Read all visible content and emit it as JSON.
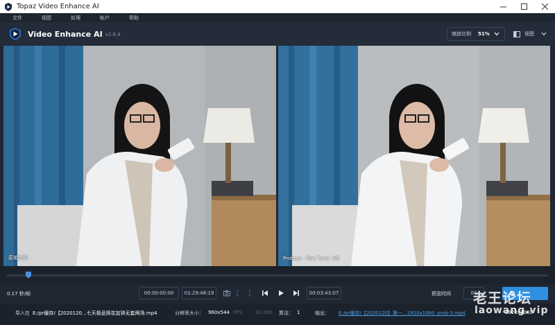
{
  "window": {
    "title": "Topaz Video Enhance AI"
  },
  "menu": [
    "文件",
    "视图",
    "处理",
    "帐户",
    "帮助"
  ],
  "header": {
    "brand": "Video Enhance AI",
    "version": "v2.6.4",
    "zoom_label": "缩放比例",
    "zoom_value": "51%",
    "view_label": "视图"
  },
  "preview": {
    "left_label": "原始比例",
    "right_label": "Proteus - Fine Tune: HD"
  },
  "timeline": {
    "position": 0.04
  },
  "controls": {
    "fps_rate": "0.17 秒/帧",
    "start_time": "00:00:00:00",
    "end_time": "01:29:48:19",
    "current_time": "00:03:43:07",
    "preview_time_label": "预览时间",
    "preview_time_value": "00"
  },
  "info": {
    "import_label": "导入在",
    "import_path": "E:/pr缓存/【2020120...七天极品探花加钟无套两场.mp4",
    "resolution_label": "分辨率大小：",
    "resolution_value": "960x544",
    "fps_label": "FPS:",
    "fps_value": "30.000",
    "algo_label": "算法：",
    "algo_value": "1",
    "output_label": "输出：",
    "output_path": "E:/pr缓存/【2020120】第一...1920x1080_prob-3.mp4",
    "output_size": "1920x1080"
  },
  "watermark": {
    "line1": "老王论坛",
    "line2": "laowang.vip"
  },
  "colors": {
    "accent": "#2f8fe0",
    "background": "#1f2733"
  }
}
